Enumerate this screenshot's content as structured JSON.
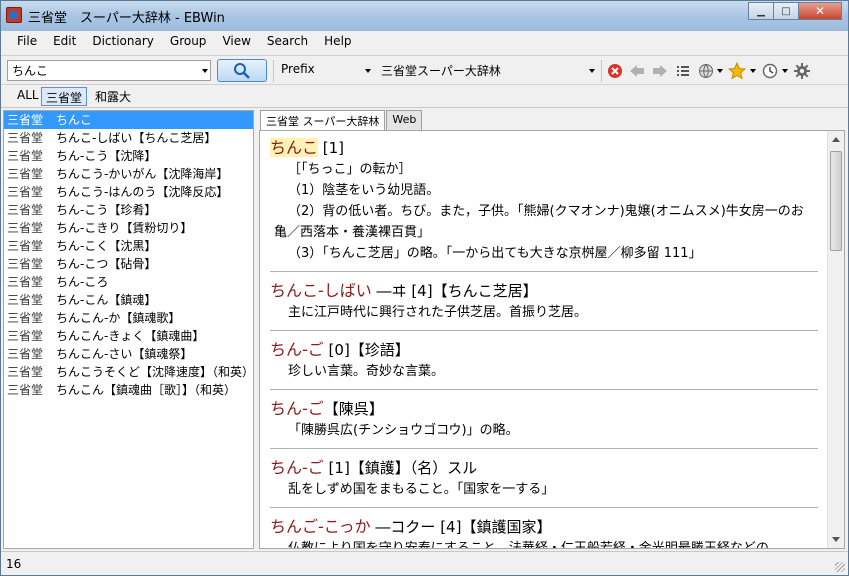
{
  "window": {
    "title": "三省堂　スーパー大辞林 - EBWin",
    "minimize_glyph": "▁",
    "maximize_glyph": "□",
    "close_glyph": "✕"
  },
  "menu": [
    {
      "label": "File"
    },
    {
      "label": "Edit"
    },
    {
      "label": "Dictionary"
    },
    {
      "label": "Group"
    },
    {
      "label": "View"
    },
    {
      "label": "Search"
    },
    {
      "label": "Help"
    }
  ],
  "toolbar": {
    "search_value": "ちんこ",
    "search_mode": "Prefix",
    "dictionary": "三省堂スーパー大辞林"
  },
  "dict_buttons": [
    "ALL",
    "三省堂",
    "和露大"
  ],
  "results": [
    {
      "dict": "三省堂",
      "text": "ちんこ"
    },
    {
      "dict": "三省堂",
      "text": "ちんこ-しばい【ちんこ芝居】"
    },
    {
      "dict": "三省堂",
      "text": "ちん-こう【沈降】"
    },
    {
      "dict": "三省堂",
      "text": "ちんこう-かいがん【沈降海岸】"
    },
    {
      "dict": "三省堂",
      "text": "ちんこう-はんのう【沈降反応】"
    },
    {
      "dict": "三省堂",
      "text": "ちん-こう【珍肴】"
    },
    {
      "dict": "三省堂",
      "text": "ちん-こきり【賃粉切り】"
    },
    {
      "dict": "三省堂",
      "text": "ちん-こく【沈黒】"
    },
    {
      "dict": "三省堂",
      "text": "ちん-こつ【砧骨】"
    },
    {
      "dict": "三省堂",
      "text": "ちん-ころ"
    },
    {
      "dict": "三省堂",
      "text": "ちん-こん【鎮魂】"
    },
    {
      "dict": "三省堂",
      "text": "ちんこん-か【鎮魂歌】"
    },
    {
      "dict": "三省堂",
      "text": "ちんこん-きょく【鎮魂曲】"
    },
    {
      "dict": "三省堂",
      "text": "ちんこん-さい【鎮魂祭】"
    },
    {
      "dict": "三省堂",
      "text": "ちんこうそくど【沈降速度】（和英）"
    },
    {
      "dict": "三省堂",
      "text": "ちんこん【鎮魂曲［歌］】（和英）"
    }
  ],
  "tabs": [
    "三省堂 スーパー大辞林",
    "Web"
  ],
  "entries": [
    {
      "headword": "ちんこ",
      "head_rest": " [1]",
      "lines": [
        "［「ちっこ」の転か］",
        "（1）陰茎をいう幼児語。",
        "（2）背の低い者。ちび。また，子供。「熊婦(クマオンナ)鬼嬢(オニムスメ)牛女房一のお",
        "亀／西落本・養漢裸百貫」",
        "（3）「ちんこ芝居」の略。「一から出ても大きな京桝屋／柳多留 111」"
      ]
    },
    {
      "headword": "ちんこ-しばい",
      "head_rest": " ―ヰ [4]【ちんこ芝居】",
      "lines": [
        "主に江戸時代に興行された子供芝居。首振り芝居。"
      ]
    },
    {
      "headword": "ちん-ご",
      "head_rest": " [0]【珍語】",
      "lines": [
        "珍しい言葉。奇妙な言葉。"
      ]
    },
    {
      "headword": "ちん-ご",
      "head_rest": "【陳呉】",
      "lines": [
        "「陳勝呉広(チンショウゴコウ)」の略。"
      ]
    },
    {
      "headword": "ちん-ご",
      "head_rest": " [1]【鎮護】（名）スル",
      "lines": [
        "乱をしずめ国をまもること。「国家を一する」"
      ]
    },
    {
      "headword": "ちんご-こっか",
      "head_rest": " ―コクー [4]【鎮護国家】",
      "lines": [
        "仏教により国を守り安泰にすること。法華経・仁王般若経・金光明最勝王経などの"
      ]
    }
  ],
  "status": {
    "count": "16"
  }
}
